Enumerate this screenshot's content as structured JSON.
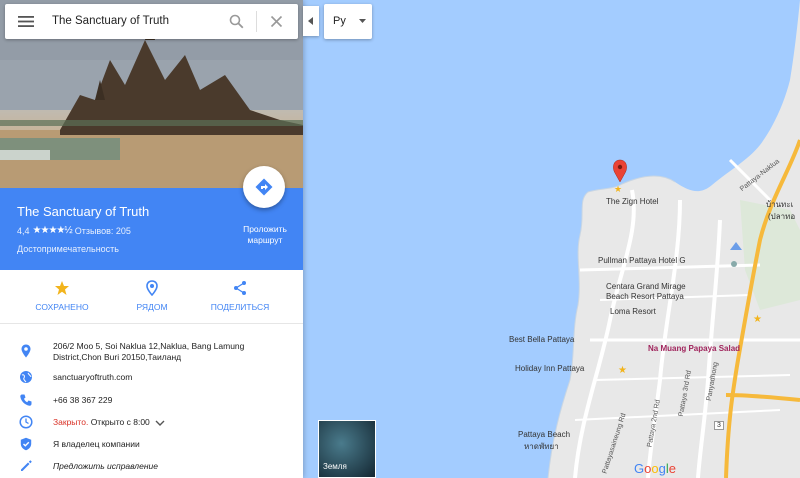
{
  "search": {
    "query": "The Sanctuary of Truth"
  },
  "language": {
    "selected": "Ру"
  },
  "place": {
    "title": "The Sanctuary of Truth",
    "rating": "4,4",
    "stars": "★★★★½",
    "reviews": "Отзывов: 205",
    "type": "Достопримечательность",
    "route_label": "Проложить маршрут"
  },
  "actions": {
    "saved": "СОХРАНЕНО",
    "nearby": "РЯДОМ",
    "share": "ПОДЕЛИТЬСЯ"
  },
  "info": {
    "address": "206/2 Moo 5, Soi Naklua 12,Naklua, Bang Lamung District,Chon Buri 20150,Таиланд",
    "website": "sanctuaryoftruth.com",
    "phone": "+66 38 367 229",
    "hours_status": "Закрыто.",
    "hours_next": "Открыто с 8:00",
    "owner": "Я владелец компании",
    "suggest_edit": "Предложить исправление"
  },
  "map": {
    "labels": {
      "zign": "The Zign Hotel",
      "pullman": "Pullman Pattaya Hotel G",
      "centara": "Centara Grand Mirage",
      "centara2": "Beach Resort Pattaya",
      "loma": "Loma Resort",
      "bella": "Best Bella Pattaya",
      "na_muang": "Na Muang Papaya Salad",
      "holiday": "Holiday Inn Pattaya",
      "beach": "Pattaya Beach",
      "beach_thai": "หาดพัทยา",
      "pattaya_naklua": "Pattaya-Naklua",
      "thai_top_1": "บ้านทะเ",
      "thai_top_2": "(ปลาทอ",
      "road_pattaya3": "Pattaya 3rd Rd",
      "road_pattaya2": "Pattaya 2nd Rd",
      "road_sai_road": "Pattayasaineung Rd",
      "road_panya": "Panyadhong",
      "route_number": "3"
    },
    "earth_label": "Земля",
    "logo": "Google"
  },
  "colors": {
    "accent": "#4285f4",
    "water": "#a3ccff",
    "land": "#e8e8e8",
    "road": "#ffffff",
    "highway": "#f6b93b",
    "closed": "#d93025"
  }
}
